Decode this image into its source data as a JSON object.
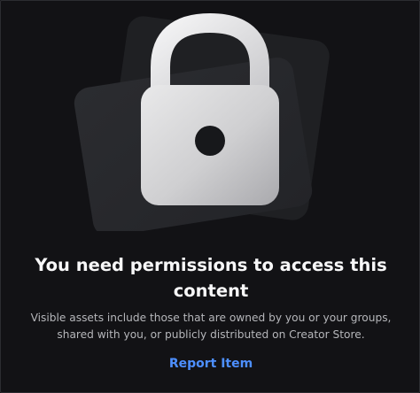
{
  "permission_notice": {
    "heading": "You need permissions to access this content",
    "description": "Visible assets include those that are owned by you or your groups, shared with you, or publicly distributed on Creator Store.",
    "report_label": "Report Item",
    "lock_icon": "lock-icon",
    "colors": {
      "background": "#121215",
      "heading": "#f7f7f8",
      "description": "#b5b6ba",
      "link": "#4d8fff"
    }
  }
}
